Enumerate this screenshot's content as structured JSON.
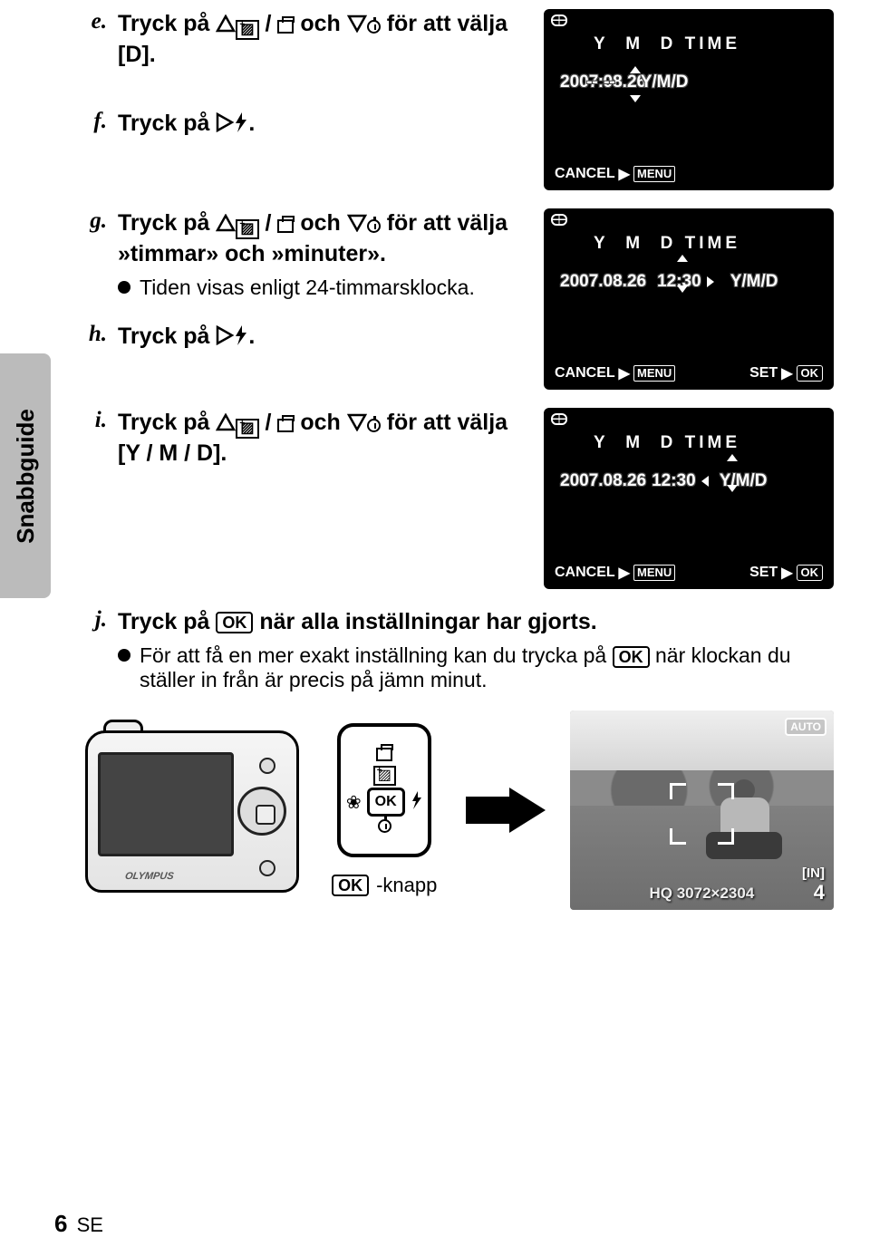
{
  "sidebar": {
    "label": "Snabbguide"
  },
  "steps": {
    "e": {
      "letter": "e.",
      "before": "Tryck på",
      "between": "och",
      "after": "för att välja [D]."
    },
    "f": {
      "letter": "f.",
      "before": "Tryck på",
      "after": "."
    },
    "g": {
      "letter": "g.",
      "before1": "Tryck på",
      "between": "och",
      "after1": "för att välja »timmar» och »minuter».",
      "bullet": "Tiden visas enligt 24-timmarsklocka."
    },
    "h": {
      "letter": "h.",
      "before": "Tryck på",
      "after": "."
    },
    "i": {
      "letter": "i.",
      "before": "Tryck på",
      "between": "och",
      "after": "för att välja [Y / M / D]."
    },
    "j": {
      "letter": "j.",
      "before": "Tryck på",
      "mid": "när alla inställningar har gjorts.",
      "bullet_before": "För att få en mer exakt inställning kan du trycka på",
      "bullet_after": "när klockan du ställer in från är precis på jämn minut."
    }
  },
  "lcd": {
    "hdr": {
      "y": "Y",
      "m": "M",
      "d": "D",
      "time": "TIME"
    },
    "screen1": {
      "date": "2007.08.26",
      "time": "--:--",
      "fmt": "Y/M/D"
    },
    "screen2": {
      "date": "2007.08.26",
      "time": "12:30",
      "fmt": "Y/M/D"
    },
    "screen3": {
      "date": "2007.08.26",
      "time": "12:30",
      "fmt": "Y/M/D"
    },
    "cancel": "CANCEL",
    "menu": "MENU",
    "set": "SET",
    "ok": "OK"
  },
  "dpad": {
    "ok": "OK",
    "label": "-knapp"
  },
  "photo": {
    "auto": "AUTO",
    "res": "HQ 3072×2304",
    "in": "[IN]",
    "count": "4"
  },
  "page": {
    "num": "6",
    "lang": "SE"
  }
}
